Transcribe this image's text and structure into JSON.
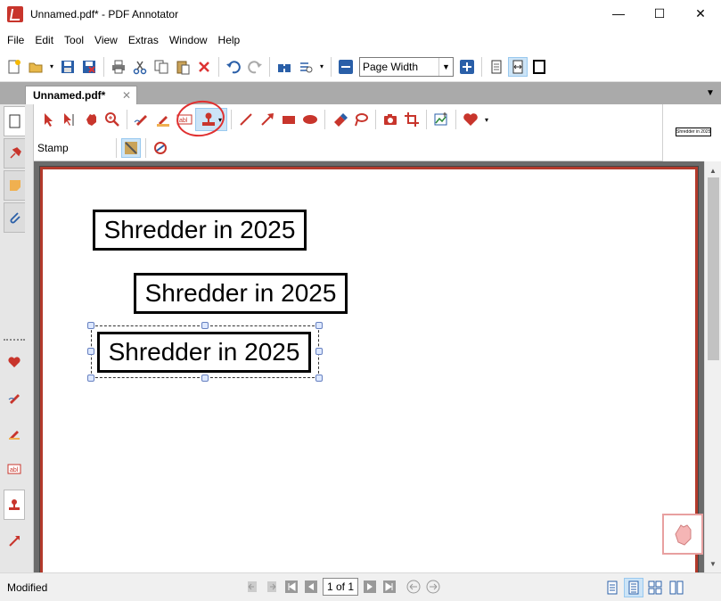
{
  "window": {
    "title": "Unnamed.pdf* - PDF Annotator",
    "minimize": "—",
    "maximize": "☐",
    "close": "✕"
  },
  "menu": [
    "File",
    "Edit",
    "Tool",
    "View",
    "Extras",
    "Window",
    "Help"
  ],
  "toolbar": {
    "zoom_value": "Page Width"
  },
  "tab": {
    "name": "Unnamed.pdf*",
    "close": "✕"
  },
  "annotation": {
    "mode_label": "Stamp"
  },
  "thumbnail": {
    "text": "Shredder in 2025"
  },
  "document": {
    "stamps": [
      "Shredder in 2025",
      "Shredder in 2025",
      "Shredder in 2025"
    ]
  },
  "status": {
    "text": "Modified",
    "page": "1 of 1"
  },
  "colors": {
    "accent_red": "#c8352c",
    "selected_blue": "#cce4f7",
    "page_border": "#b33a2b"
  }
}
